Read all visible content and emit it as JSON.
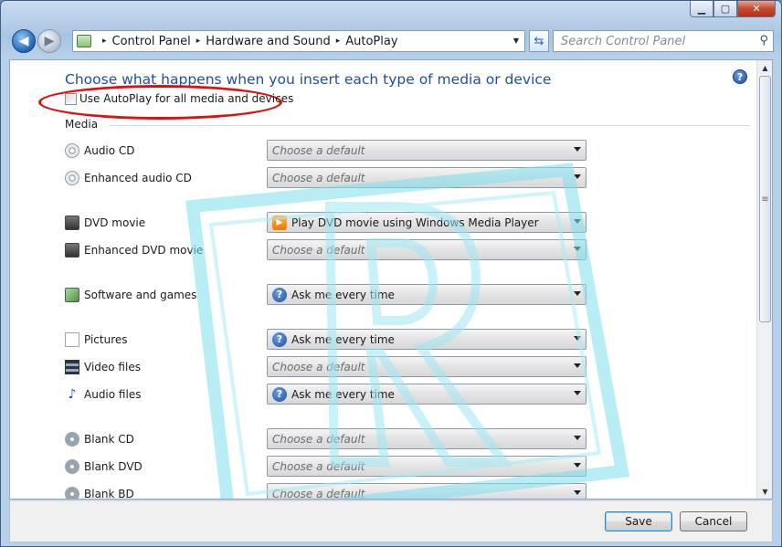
{
  "window": {
    "caption_buttons": {
      "minimize": "▁",
      "maximize": "▢",
      "close": "✕"
    }
  },
  "nav": {
    "back_glyph": "◀",
    "forward_glyph": "▶",
    "breadcrumbs": [
      "Control Panel",
      "Hardware and Sound",
      "AutoPlay"
    ],
    "crumb_separator": "▸",
    "search_placeholder": "Search Control Panel",
    "refresh_glyph": "⇆"
  },
  "content": {
    "heading": "Choose what happens when you insert each type of media or device",
    "autoplay_checkbox_label": "Use AutoPlay for all media and devices",
    "autoplay_checked": false,
    "section_media": "Media",
    "help_glyph": "?",
    "rows": [
      {
        "label": "Audio CD",
        "icon": "audio-cd-icon",
        "value": "Choose a default",
        "placeholder": true,
        "dd_icon": ""
      },
      {
        "label": "Enhanced audio CD",
        "icon": "enhanced-audio-cd-icon",
        "value": "Choose a default",
        "placeholder": true,
        "dd_icon": ""
      },
      {
        "label": "DVD movie",
        "icon": "dvd-movie-icon",
        "value": "Play DVD movie using Windows Media Player",
        "placeholder": false,
        "dd_icon": "wmp"
      },
      {
        "label": "Enhanced DVD movie",
        "icon": "enhanced-dvd-movie-icon",
        "value": "Choose a default",
        "placeholder": true,
        "dd_icon": ""
      },
      {
        "label": "Software and games",
        "icon": "software-games-icon",
        "value": "Ask me every time",
        "placeholder": false,
        "dd_icon": "ask"
      },
      {
        "label": "Pictures",
        "icon": "pictures-icon",
        "value": "Ask me every time",
        "placeholder": false,
        "dd_icon": "ask"
      },
      {
        "label": "Video files",
        "icon": "video-files-icon",
        "value": "Choose a default",
        "placeholder": true,
        "dd_icon": ""
      },
      {
        "label": "Audio files",
        "icon": "audio-files-icon",
        "value": "Ask me every time",
        "placeholder": false,
        "dd_icon": "ask"
      },
      {
        "label": "Blank CD",
        "icon": "blank-cd-icon",
        "value": "Choose a default",
        "placeholder": true,
        "dd_icon": ""
      },
      {
        "label": "Blank DVD",
        "icon": "blank-dvd-icon",
        "value": "Choose a default",
        "placeholder": true,
        "dd_icon": ""
      },
      {
        "label": "Blank BD",
        "icon": "blank-bd-icon",
        "value": "Choose a default",
        "placeholder": true,
        "dd_icon": ""
      }
    ]
  },
  "footer": {
    "save_label": "Save",
    "cancel_label": "Cancel"
  },
  "colors": {
    "heading": "#1e4fa0",
    "annotation": "#e01010",
    "watermark": "#7fdff0"
  }
}
